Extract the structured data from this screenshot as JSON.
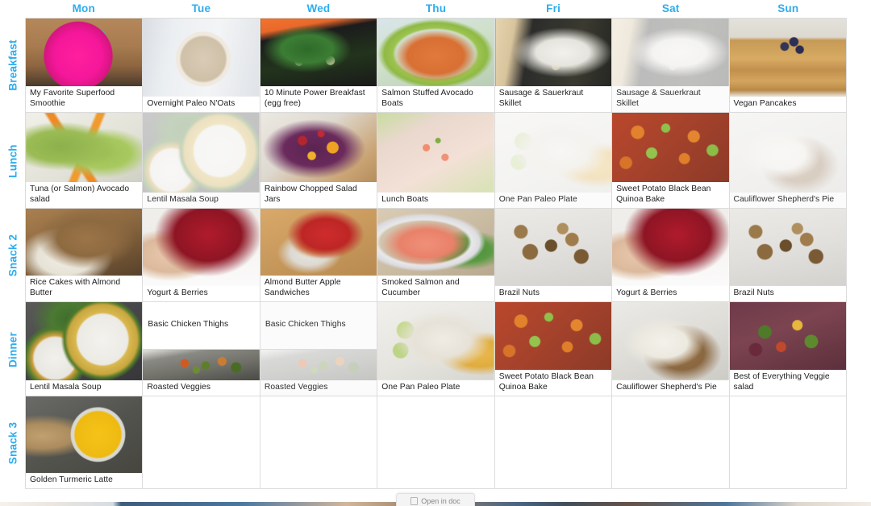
{
  "theme": {
    "accent_blue": "#2badee",
    "grid_border": "#dcdcdc",
    "cell_background": "#ffffff",
    "text_color": "#1d1d1d"
  },
  "header": {
    "days": [
      {
        "label": "Mon"
      },
      {
        "label": "Tue"
      },
      {
        "label": "Wed"
      },
      {
        "label": "Thu"
      },
      {
        "label": "Fri"
      },
      {
        "label": "Sat"
      },
      {
        "label": "Sun"
      }
    ]
  },
  "rows": [
    {
      "label": "Breakfast",
      "cells": [
        {
          "faded": false,
          "items": [
            {
              "title": "My Favorite Superfood Smoothie",
              "photo": "smoothie",
              "has_photo": true
            }
          ]
        },
        {
          "faded": false,
          "items": [
            {
              "title": "Overnight Paleo N'Oats",
              "photo": "oats",
              "has_photo": true
            }
          ]
        },
        {
          "faded": false,
          "items": [
            {
              "title": "10 Minute Power Breakfast (egg free)",
              "photo": "spinach-skillet",
              "has_photo": true
            }
          ]
        },
        {
          "faded": false,
          "items": [
            {
              "title": "Salmon Stuffed Avocado Boats",
              "photo": "salmon-avocado",
              "has_photo": true
            }
          ]
        },
        {
          "faded": false,
          "items": [
            {
              "title": "Sausage & Sauerkraut Skillet",
              "photo": "sauerkraut-skillet",
              "has_photo": true
            }
          ]
        },
        {
          "faded": true,
          "items": [
            {
              "title": "Sausage & Sauerkraut Skillet",
              "photo": "sauerkraut-skillet",
              "has_photo": true
            }
          ]
        },
        {
          "faded": false,
          "items": [
            {
              "title": "Vegan Pancakes",
              "photo": "pancakes",
              "has_photo": true
            }
          ]
        }
      ]
    },
    {
      "label": "Lunch",
      "cells": [
        {
          "faded": false,
          "items": [
            {
              "title": "Tuna (or Salmon) Avocado salad",
              "photo": "tuna-avocado",
              "has_photo": true
            }
          ]
        },
        {
          "faded": true,
          "items": [
            {
              "title": "Lentil Masala Soup",
              "photo": "lentil-soup",
              "has_photo": true
            }
          ]
        },
        {
          "faded": false,
          "items": [
            {
              "title": "Rainbow Chopped Salad Jars",
              "photo": "rainbow-salad",
              "has_photo": true
            }
          ]
        },
        {
          "faded": false,
          "items": [
            {
              "title": "Lunch Boats",
              "photo": "lunch-boats",
              "has_photo": true
            }
          ]
        },
        {
          "faded": true,
          "items": [
            {
              "title": "One Pan Paleo Plate",
              "photo": "paleo-plate",
              "has_photo": true
            }
          ]
        },
        {
          "faded": false,
          "items": [
            {
              "title": "Sweet Potato Black Bean Quinoa Bake",
              "photo": "quinoa-bake",
              "has_photo": true
            }
          ]
        },
        {
          "faded": true,
          "items": [
            {
              "title": "Cauliflower Shepherd's Pie",
              "photo": "shepherds-pie",
              "has_photo": true
            }
          ]
        }
      ]
    },
    {
      "label": "Snack 2",
      "cells": [
        {
          "faded": false,
          "items": [
            {
              "title": "Rice Cakes with Almond Butter",
              "photo": "rice-cakes",
              "has_photo": true
            }
          ]
        },
        {
          "faded": false,
          "items": [
            {
              "title": "Yogurt & Berries",
              "photo": "yogurt-berries",
              "has_photo": true
            }
          ]
        },
        {
          "faded": false,
          "items": [
            {
              "title": "Almond Butter Apple Sandwiches",
              "photo": "apple-sandwich",
              "has_photo": true
            }
          ]
        },
        {
          "faded": false,
          "items": [
            {
              "title": "Smoked Salmon and Cucumber",
              "photo": "smoked-salmon",
              "has_photo": true
            }
          ]
        },
        {
          "faded": false,
          "items": [
            {
              "title": "Brazil Nuts",
              "photo": "brazil-nuts",
              "has_photo": true
            }
          ]
        },
        {
          "faded": false,
          "items": [
            {
              "title": "Yogurt & Berries",
              "photo": "yogurt-berries",
              "has_photo": true
            }
          ]
        },
        {
          "faded": false,
          "items": [
            {
              "title": "Brazil Nuts",
              "photo": "brazil-nuts",
              "has_photo": true
            }
          ]
        }
      ]
    },
    {
      "label": "Dinner",
      "cells": [
        {
          "faded": false,
          "items": [
            {
              "title": "Lentil Masala Soup",
              "photo": "lentil-soup",
              "has_photo": true
            }
          ]
        },
        {
          "faded": false,
          "items": [
            {
              "title": "Basic Chicken Thighs",
              "photo": "",
              "has_photo": false
            },
            {
              "title": "Roasted Veggies",
              "photo": "roasted-veggies",
              "has_photo": true
            }
          ]
        },
        {
          "faded": true,
          "items": [
            {
              "title": "Basic Chicken Thighs",
              "photo": "",
              "has_photo": false
            },
            {
              "title": "Roasted Veggies",
              "photo": "roasted-veggies",
              "has_photo": true
            }
          ]
        },
        {
          "faded": false,
          "items": [
            {
              "title": "One Pan Paleo Plate",
              "photo": "paleo-plate",
              "has_photo": true
            }
          ]
        },
        {
          "faded": false,
          "items": [
            {
              "title": "Sweet Potato Black Bean Quinoa Bake",
              "photo": "quinoa-bake",
              "has_photo": true
            }
          ]
        },
        {
          "faded": false,
          "items": [
            {
              "title": "Cauliflower Shepherd's Pie",
              "photo": "shepherds-pie",
              "has_photo": true
            }
          ]
        },
        {
          "faded": false,
          "items": [
            {
              "title": "Best of Everything Veggie salad",
              "photo": "veggie-salad",
              "has_photo": true
            }
          ]
        }
      ]
    },
    {
      "label": "Snack 3",
      "cells": [
        {
          "faded": false,
          "items": [
            {
              "title": "Golden Turmeric Latte",
              "photo": "turmeric-latte",
              "has_photo": true
            }
          ]
        },
        {
          "faded": false,
          "items": []
        },
        {
          "faded": false,
          "items": []
        },
        {
          "faded": false,
          "items": []
        },
        {
          "faded": false,
          "items": []
        },
        {
          "faded": false,
          "items": []
        },
        {
          "faded": false,
          "items": []
        }
      ]
    }
  ],
  "bottom_overlay": {
    "tooltip_label": "Open in doc",
    "tooltip_icon": "document-icon"
  }
}
